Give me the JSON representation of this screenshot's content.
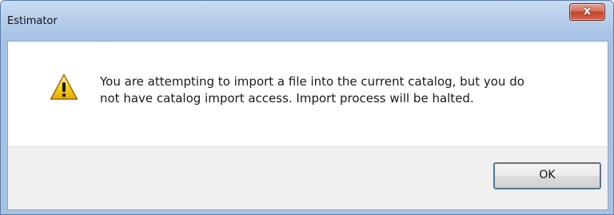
{
  "window": {
    "title": "Estimator",
    "close_glyph": "x",
    "close_icon": "close-icon"
  },
  "message": {
    "icon": "warning-icon",
    "text": "You are attempting to import a file into the current catalog, but you do\nnot have catalog import access.  Import process will be halted."
  },
  "buttons": {
    "ok_label": "OK"
  },
  "colors": {
    "titlebar": "#b9d0ec",
    "close_button": "#c0432c",
    "warning_fill": "#f5c400",
    "button_face": "#e5e5e5"
  }
}
